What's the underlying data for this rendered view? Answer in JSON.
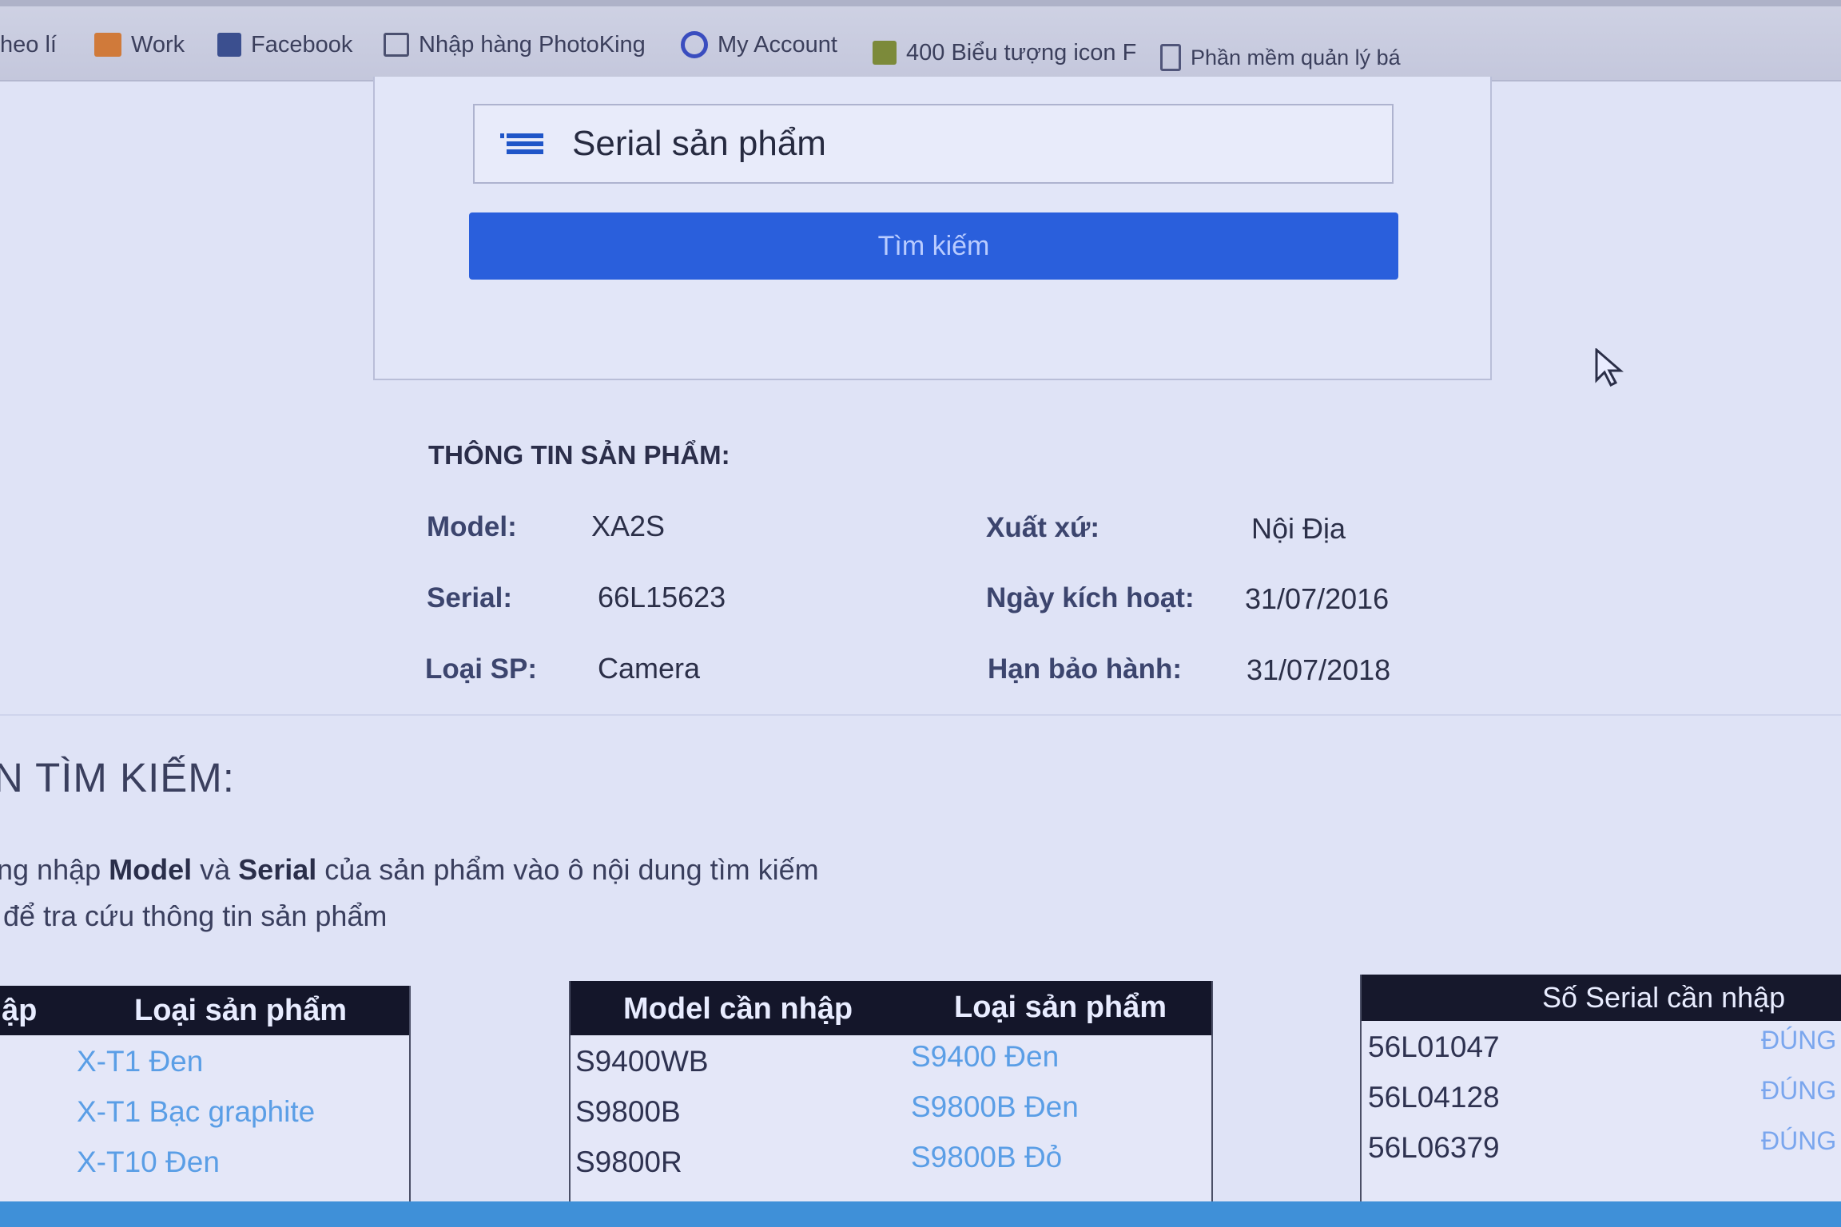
{
  "bookmarks": [
    {
      "label": "heo lí"
    },
    {
      "label": "Work"
    },
    {
      "label": "Facebook"
    },
    {
      "label": "Nhập hàng PhotoKing"
    },
    {
      "label": "My Account"
    },
    {
      "label": "400 Biểu tượng icon F"
    },
    {
      "label": "Phần mềm quản lý bá"
    }
  ],
  "search": {
    "placeholder": "Serial sản phẩm",
    "button_label": "Tìm kiếm"
  },
  "product_info": {
    "heading": "THÔNG TIN SẢN PHẨM:",
    "model_label": "Model:",
    "model_value": "XA2S",
    "serial_label": "Serial:",
    "serial_value": "66L15623",
    "type_label": "Loại SP:",
    "type_value": "Camera",
    "origin_label": "Xuất xứ:",
    "origin_value": "Nội Địa",
    "activation_label": "Ngày kích hoạt:",
    "activation_value": "31/07/2016",
    "warranty_label": "Hạn bảo hành:",
    "warranty_value": "31/07/2018"
  },
  "guide": {
    "heading": "N TÌM KIẾM:",
    "line1_prefix": "ng nhập ",
    "line1_model": "Model",
    "line1_and": " và ",
    "line1_serial": "Serial",
    "line1_suffix": " của sản phẩm vào ô nội dung tìm kiếm",
    "line2": "để tra cứu thông tin sản phẩm"
  },
  "table1": {
    "col1": "ập",
    "col2": "Loại sản phẩm",
    "rows": [
      "X-T1 Đen",
      "X-T1 Bạc graphite",
      "X-T10 Đen"
    ]
  },
  "table2": {
    "col1": "Model cần nhập",
    "col2": "Loại sản phẩm",
    "rows": [
      {
        "model": "S9400WB",
        "type": "S9400 Đen"
      },
      {
        "model": "S9800B",
        "type": "S9800B Đen"
      },
      {
        "model": "S9800R",
        "type": "S9800B Đỏ"
      }
    ]
  },
  "table3": {
    "col1": "Số Serial cần nhập",
    "rows": [
      {
        "serial": "56L01047",
        "status": "ĐÚNG"
      },
      {
        "serial": "56L04128",
        "status": "ĐÚNG"
      },
      {
        "serial": "56L06379",
        "status": "ĐÚNG"
      }
    ]
  },
  "colors": {
    "primary_button": "#2a5fdc",
    "link": "#5a9ee6",
    "table_header": "#14162a"
  }
}
